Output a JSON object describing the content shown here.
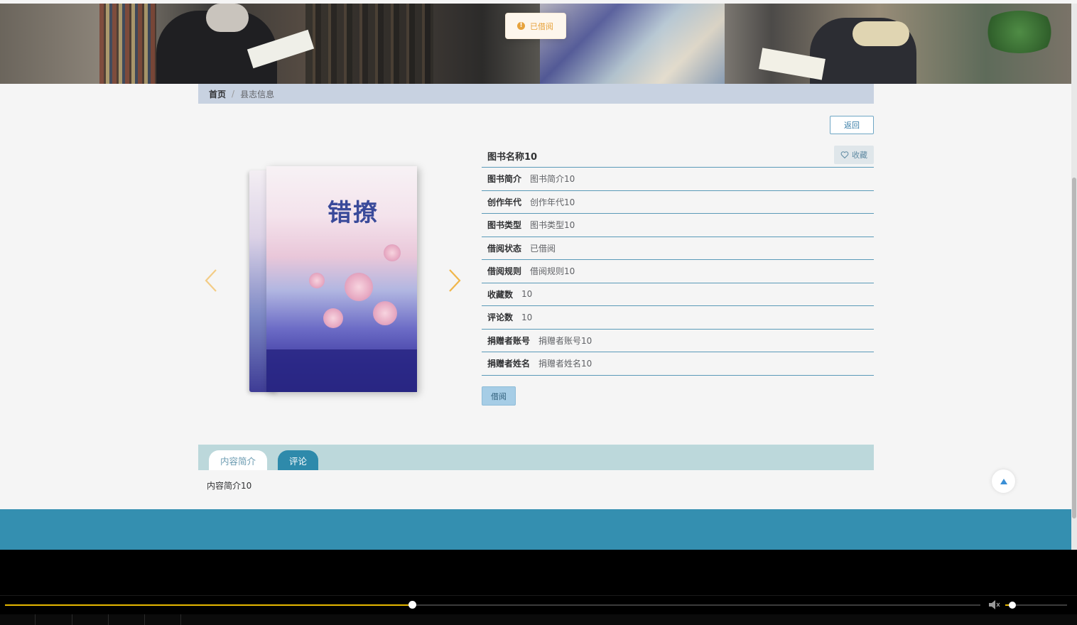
{
  "toast": {
    "message": "已借阅",
    "icon": "warning-icon",
    "color": "#e6a23c"
  },
  "breadcrumb": {
    "home": "首页",
    "separator": "/",
    "current": "县志信息"
  },
  "actions": {
    "back_label": "返回",
    "favorite_label": "收藏",
    "borrow_label": "借阅"
  },
  "book": {
    "title": "图书名称10",
    "cover_title": "错撩",
    "fields": [
      {
        "label": "图书简介",
        "value": "图书简介10"
      },
      {
        "label": "创作年代",
        "value": "创作年代10"
      },
      {
        "label": "图书类型",
        "value": "图书类型10"
      },
      {
        "label": "借阅状态",
        "value": "已借阅"
      },
      {
        "label": "借阅规则",
        "value": "借阅规则10"
      },
      {
        "label": "收藏数",
        "value": "10"
      },
      {
        "label": "评论数",
        "value": "10"
      },
      {
        "label": "捐赠者账号",
        "value": "捐赠者账号10"
      },
      {
        "label": "捐赠者姓名",
        "value": "捐赠者姓名10"
      }
    ]
  },
  "tabs": [
    {
      "label": "内容简介",
      "active": false
    },
    {
      "label": "评论",
      "active": true
    }
  ],
  "content": {
    "text": "内容简介10"
  },
  "player": {
    "progress_fraction": 0.417,
    "volume_fraction": 0.09
  },
  "colors": {
    "accent": "#348fb0",
    "breadcrumb_bg": "#c8d2e1",
    "tab_bar_bg": "#bcd8db",
    "arrow": "#f0b64a",
    "progress": "#e6b800"
  }
}
